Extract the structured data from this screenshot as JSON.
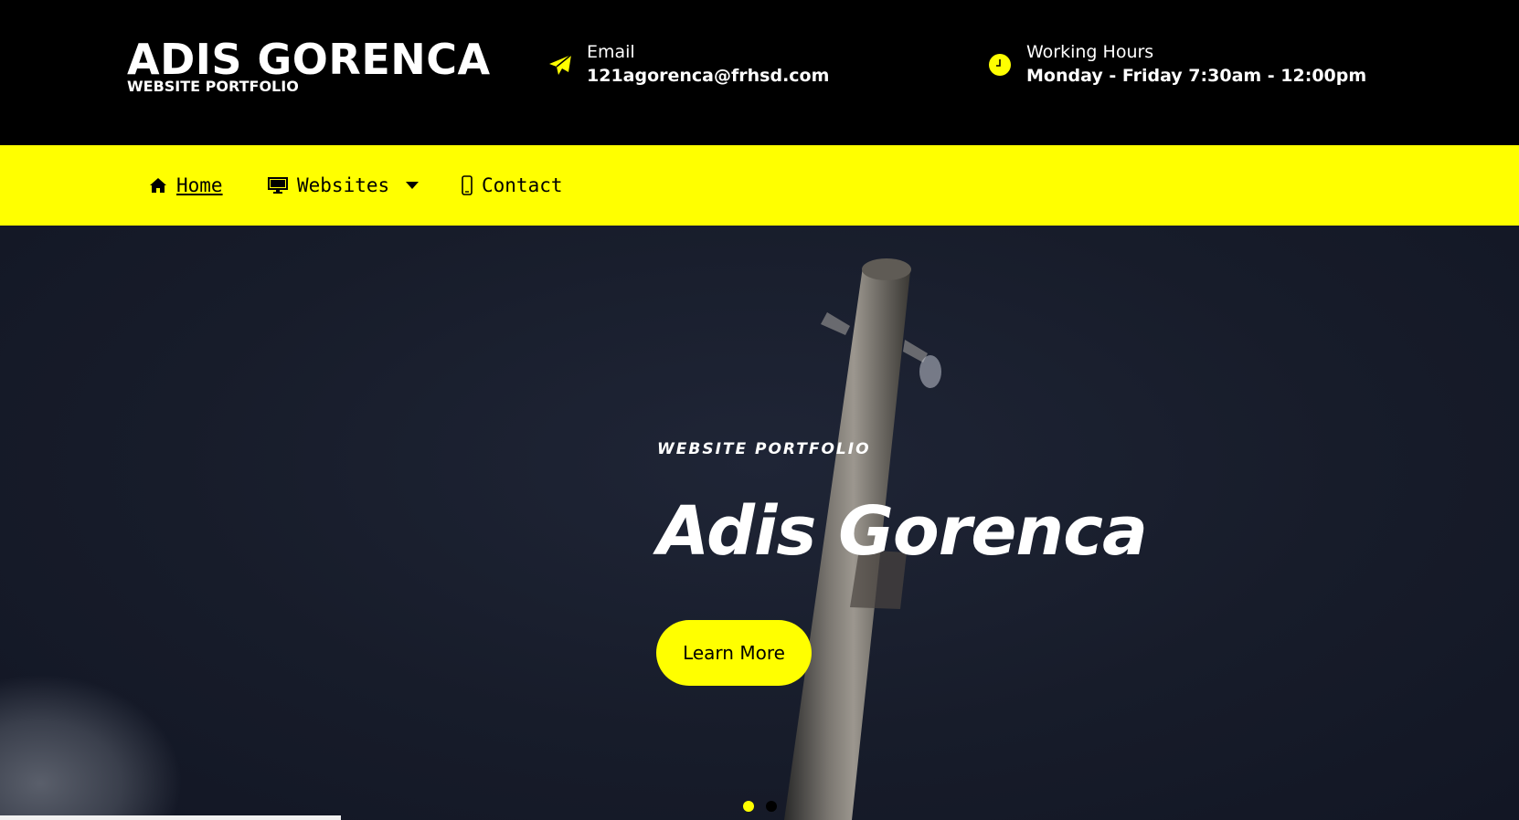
{
  "header": {
    "brand_title": "ADIS GORENCA",
    "brand_subtitle": "WEBSITE PORTFOLIO",
    "email_label": "Email",
    "email_value": "121agorenca@frhsd.com",
    "hours_label": "Working Hours",
    "hours_value": "Monday - Friday 7:30am - 12:00pm",
    "email_icon": "paper-plane-icon",
    "hours_icon": "clock-icon"
  },
  "nav": {
    "items": [
      {
        "label": " Home",
        "icon": "home-icon",
        "active": true
      },
      {
        "label": "Websites",
        "icon": "monitor-icon",
        "dropdown": true
      },
      {
        "label": "Contact",
        "icon": "mobile-phone-icon"
      }
    ]
  },
  "hero": {
    "kicker": "WEBSITE PORTFOLIO",
    "title": "Adis Gorenca",
    "button_label": "Learn More",
    "slides": 2,
    "active_slide": 1
  },
  "colors": {
    "accent": "#ffff00",
    "topbar": "#000000",
    "hero_bg": "#171c2a",
    "text_light": "#ffffff"
  }
}
